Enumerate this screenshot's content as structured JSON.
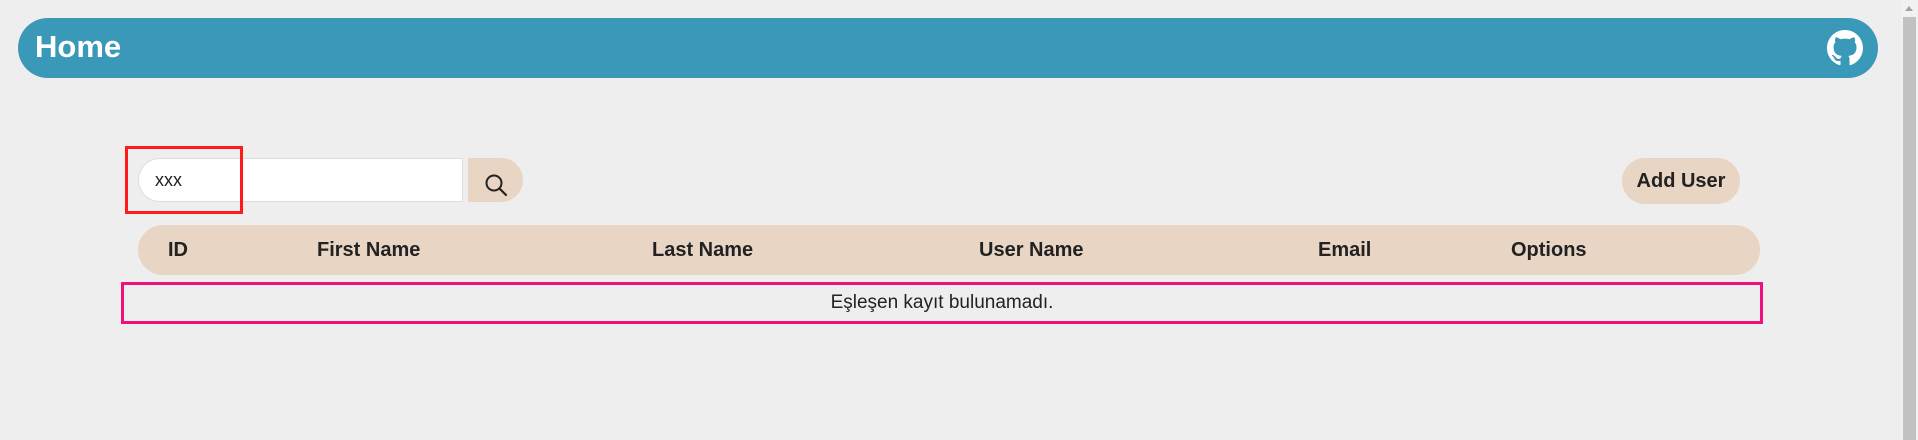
{
  "header": {
    "title": "Home",
    "icon": "github-icon",
    "background": "#3a98b9"
  },
  "search": {
    "value": "xxx",
    "placeholder": "",
    "button_icon": "search-icon"
  },
  "toolbar": {
    "add_user_label": "Add User"
  },
  "table": {
    "columns": [
      "ID",
      "First Name",
      "Last Name",
      "User Name",
      "Email",
      "Options"
    ],
    "empty_message": "Eşleşen kayıt bulunamadı."
  },
  "colors": {
    "accent": "#3a98b9",
    "beige": "#e8d5c4",
    "background": "#eeeeee",
    "highlight_red": "#ff1a1a",
    "highlight_pink": "#f0127b"
  }
}
